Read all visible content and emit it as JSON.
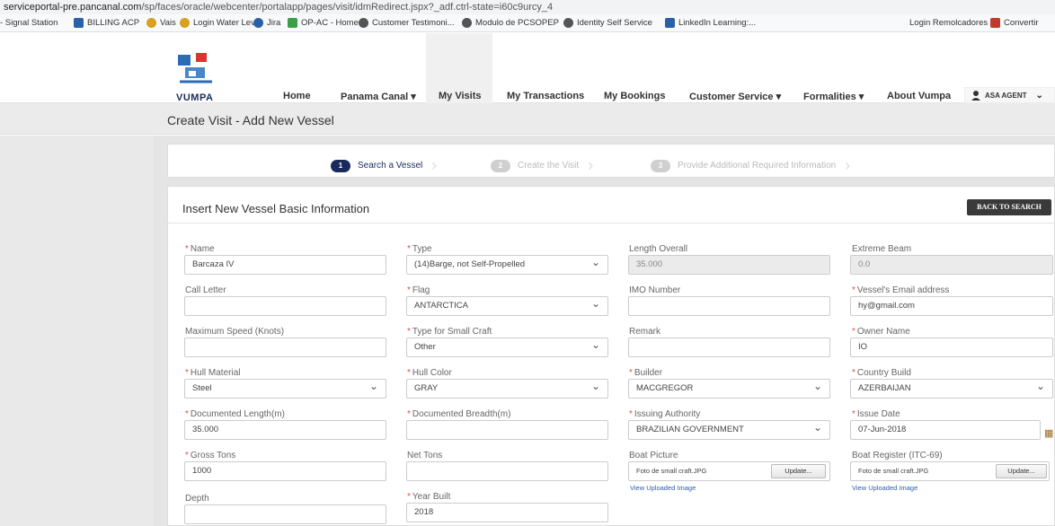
{
  "browser": {
    "url_domain": "serviceportal-pre.pancanal.com",
    "url_path": "/sp/faces/oracle/webcenter/portalapp/pages/visit/idmRedirect.jspx?_adf.ctrl-state=i60c9urcy_4",
    "bookmarks": [
      {
        "label": "- Signal Station",
        "icon_color": ""
      },
      {
        "label": "BILLING ACP",
        "icon_color": "#2b5fa8"
      },
      {
        "label": "Vais",
        "icon_color": "#d8a020"
      },
      {
        "label": "Login Water Level",
        "icon_color": "#d8a020"
      },
      {
        "label": "Jira",
        "icon_color": "#2b5fa8"
      },
      {
        "label": "OP-AC - Home",
        "icon_color": "#3aa047"
      },
      {
        "label": "Customer Testimoni...",
        "icon_color": "#555555"
      },
      {
        "label": "Modulo de PCSOPEP",
        "icon_color": "#555555"
      },
      {
        "label": "Identity Self Service",
        "icon_color": "#555555"
      },
      {
        "label": "LinkedIn Learning:...",
        "icon_color": "#2b5fa8"
      },
      {
        "label": "Login Remolcadores",
        "icon_color": ""
      },
      {
        "label": "Convertir",
        "icon_color": "#c0392b"
      }
    ]
  },
  "nav": {
    "logo_text": "VUMPA",
    "items": [
      "Home",
      "Panama Canal ▾",
      "My Visits",
      "My Transactions",
      "My Bookings",
      "Customer Service ▾",
      "Formalities ▾",
      "About Vumpa"
    ],
    "user": "ASA AGENT"
  },
  "page_title": "Create Visit - Add New Vessel",
  "steps": [
    {
      "num": "1",
      "label": "Search a Vessel"
    },
    {
      "num": "2",
      "label": "Create the Visit"
    },
    {
      "num": "3",
      "label": "Provide Additional Required Information"
    }
  ],
  "panel": {
    "title": "Insert New Vessel Basic Information",
    "back_button": "BACK TO SEARCH"
  },
  "fields": {
    "name": {
      "label": "Name",
      "value": ""
    },
    "type": {
      "label": "Type",
      "value": "(14)Barge, not Self-Propelled"
    },
    "length_overall": {
      "label": "Length Overall",
      "value": "35.000"
    },
    "extreme_beam": {
      "label": "Extreme Beam",
      "value": "0.0"
    },
    "call_letter": {
      "label": "Call Letter",
      "value": ""
    },
    "flag": {
      "label": "Flag",
      "value": "ANTARCTICA"
    },
    "imo_number": {
      "label": "IMO Number",
      "value": ""
    },
    "email": {
      "label": "Vessel's Email address",
      "value": "hy@gmail.com"
    },
    "max_speed": {
      "label": "Maximum Speed (Knots)",
      "value": ""
    },
    "small_craft_type": {
      "label": "Type for Small Craft",
      "value": "Other"
    },
    "remark": {
      "label": "Remark",
      "value": ""
    },
    "owner_name": {
      "label": "Owner Name",
      "value": "IO"
    },
    "hull_material": {
      "label": "Hull Material",
      "value": "Steel"
    },
    "hull_color": {
      "label": "Hull Color",
      "value": "GRAY"
    },
    "builder": {
      "label": "Builder",
      "value": "MACGREGOR"
    },
    "country_build": {
      "label": "Country Build",
      "value": "AZERBAIJAN"
    },
    "doc_length": {
      "label": "Documented Length(m)",
      "value": "35.000"
    },
    "doc_breadth": {
      "label": "Documented Breadth(m)",
      "value": ""
    },
    "issuing_authority": {
      "label": "Issuing Authority",
      "value": "BRAZILIAN GOVERNMENT"
    },
    "issue_date": {
      "label": "Issue Date",
      "value": "07-Jun-2018"
    },
    "gross_tons": {
      "label": "Gross Tons",
      "value": "1000"
    },
    "net_tons": {
      "label": "Net Tons",
      "value": ""
    },
    "boat_picture": {
      "label": "Boat Picture",
      "file": "Foto de small craft.JPG",
      "button": "Update...",
      "link": "View Uploaded Image"
    },
    "boat_register": {
      "label": "Boat Register (ITC-69)",
      "file": "Foto de small craft.JPG",
      "button": "Update...",
      "link": "View Uploaded Image"
    },
    "depth": {
      "label": "Depth",
      "value": ""
    },
    "year_built": {
      "label": "Year Built",
      "value": "2018"
    }
  },
  "colors": {
    "required_marker": "#e84c3d",
    "active_step": "#1a2a5c",
    "inactive_step": "#cfcfcf",
    "back_button_bg": "#3a3a3a"
  }
}
